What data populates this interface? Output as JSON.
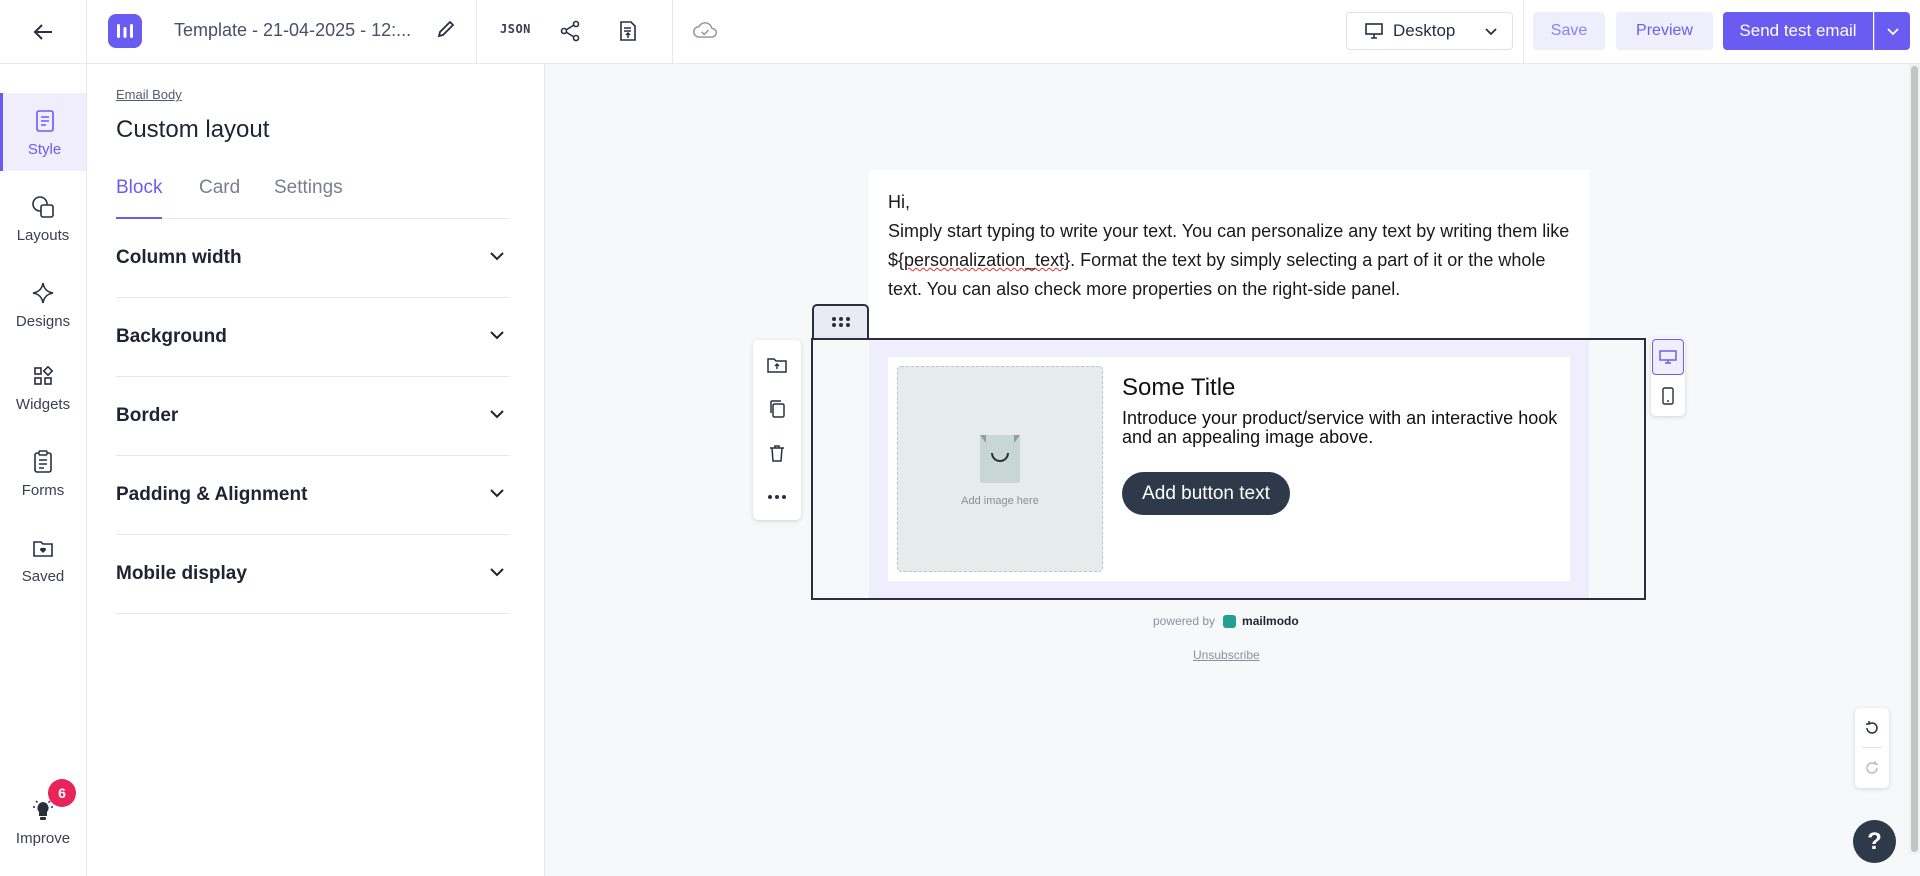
{
  "topbar": {
    "title": "Template - 21-04-2025 - 12:...",
    "json_label": "JSON",
    "device": "Desktop",
    "save_label": "Save",
    "preview_label": "Preview",
    "send_label": "Send test email"
  },
  "rail": {
    "items": [
      {
        "label": "Style",
        "icon": "style-icon",
        "active": true
      },
      {
        "label": "Layouts",
        "icon": "layouts-icon"
      },
      {
        "label": "Designs",
        "icon": "sparkle-icon"
      },
      {
        "label": "Widgets",
        "icon": "widgets-icon"
      },
      {
        "label": "Forms",
        "icon": "forms-icon"
      },
      {
        "label": "Saved",
        "icon": "saved-folder-icon"
      }
    ],
    "improve": {
      "label": "Improve",
      "badge": "6"
    }
  },
  "panel": {
    "breadcrumb": "Email Body",
    "title": "Custom layout",
    "tabs": [
      "Block",
      "Card",
      "Settings"
    ],
    "active_tab": "Block",
    "sections": [
      "Column width",
      "Background",
      "Border",
      "Padding & Alignment",
      "Mobile display"
    ]
  },
  "email": {
    "greeting": "Hi,",
    "body_before": "Simply start typing to write your text. You can personalize any text by writing them like ${",
    "body_token": "personalization_text",
    "body_after": "}. Format the text by simply selecting a part of it or the whole text. You can also check more properties on the right-side panel.",
    "image_caption": "Add image here",
    "card_title": "Some Title",
    "card_description": "Introduce your product/service with an interactive hook and an appealing image above.",
    "card_button": "Add button text",
    "powered_by": "powered by",
    "brand": "mailmodo",
    "unsubscribe": "Unsubscribe"
  },
  "help_label": "?",
  "colors": {
    "accent": "#6a5cf0",
    "badge": "#e8245a",
    "card_button": "#2e3a4a",
    "block_bg": "#f0eefd"
  }
}
